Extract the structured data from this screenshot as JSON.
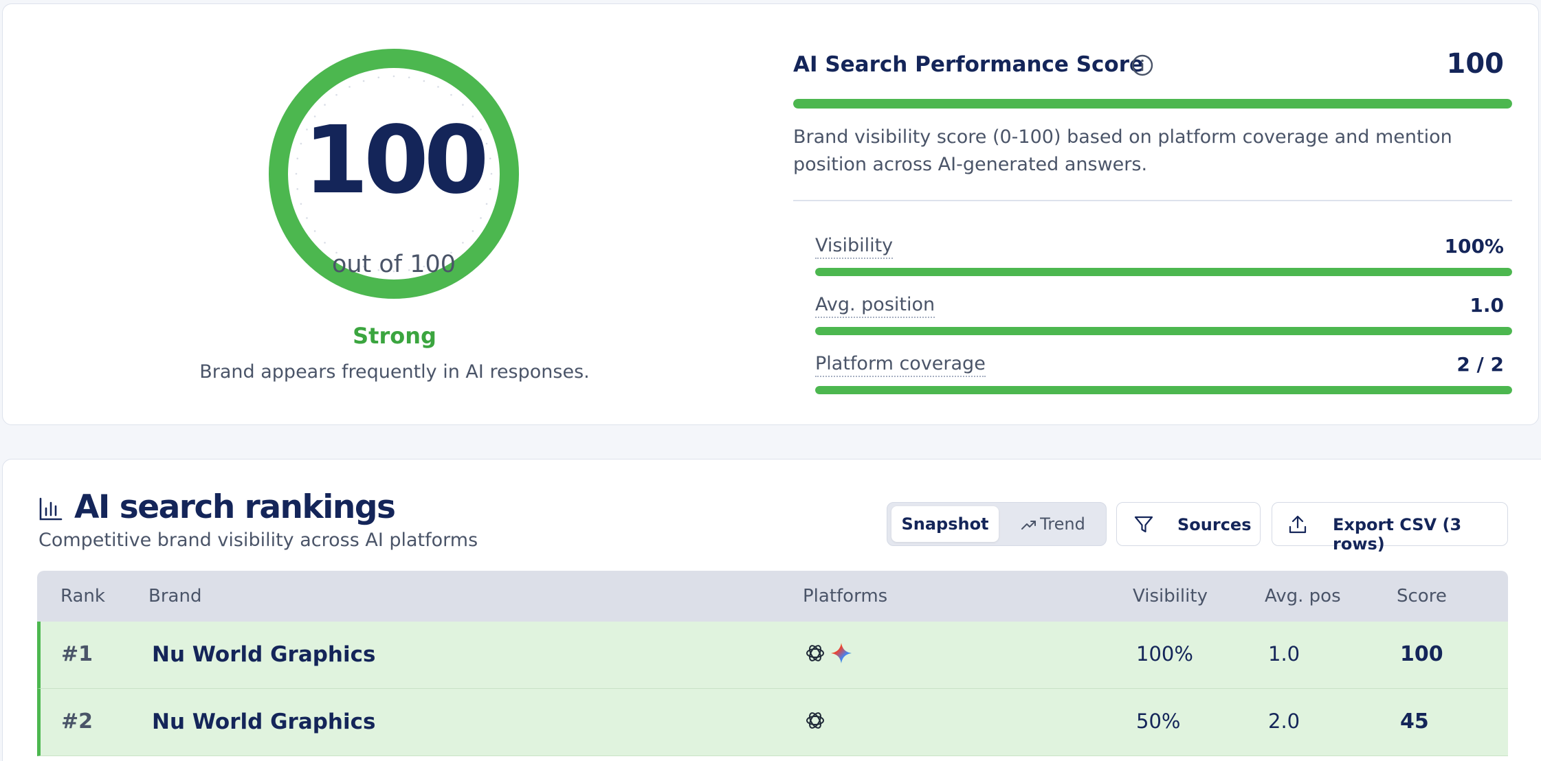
{
  "score_card": {
    "gauge": {
      "value": "100",
      "subtitle": "out of 100",
      "fraction": 1.0
    },
    "label": "Strong",
    "description": "Brand appears frequently in AI responses.",
    "title": "AI Search Performance Score",
    "value": "100",
    "fraction": 1.0,
    "explanation": "Brand visibility score (0-100) based on platform coverage and mention position across AI-generated answers.",
    "metrics": [
      {
        "label": "Visibility",
        "value": "100%",
        "fraction": 1.0
      },
      {
        "label": "Avg. position",
        "value": "1.0",
        "fraction": 1.0
      },
      {
        "label": "Platform coverage",
        "value": "2 / 2",
        "fraction": 1.0
      }
    ]
  },
  "rankings": {
    "title": "AI search rankings",
    "subtitle": "Competitive brand visibility across AI platforms",
    "view_toggle": {
      "snapshot": "Snapshot",
      "trend": "Trend",
      "selected": "Snapshot"
    },
    "sources_label": "Sources",
    "export_label": "Export CSV (3 rows)",
    "columns": [
      "Rank",
      "Brand",
      "Platforms",
      "Visibility",
      "Avg. pos",
      "Score"
    ],
    "rows": [
      {
        "rank": "#1",
        "brand": "Nu World Graphics",
        "platforms": [
          "chatgpt-icon",
          "gemini-icon"
        ],
        "visibility": "100%",
        "avg_pos": "1.0",
        "score": "100"
      },
      {
        "rank": "#2",
        "brand": "Nu World Graphics",
        "platforms": [
          "chatgpt-icon"
        ],
        "visibility": "50%",
        "avg_pos": "2.0",
        "score": "45"
      }
    ]
  },
  "colors": {
    "accent_green": "#4cb74f",
    "label_green": "#3ba53f",
    "navy": "#142559",
    "row_highlight": "#e0f3de"
  },
  "icons": {
    "info": "info-icon",
    "rankings": "bar-chart-icon",
    "trend": "trend-up-icon",
    "sources": "filter-icon",
    "export": "upload-icon"
  }
}
